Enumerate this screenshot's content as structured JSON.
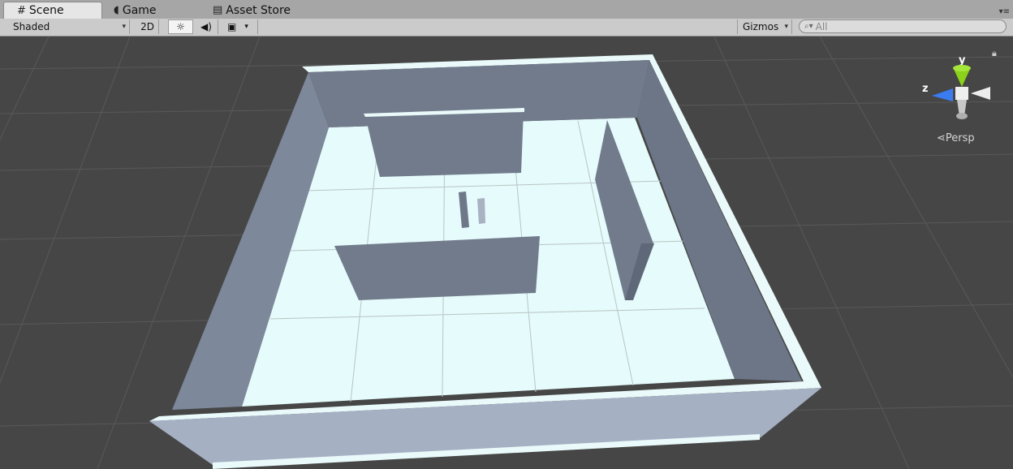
{
  "tabs": [
    {
      "label": "Scene",
      "icon": "grid-hash-icon",
      "active": true
    },
    {
      "label": "Game",
      "icon": "pacman-icon",
      "active": false
    },
    {
      "label": "Asset Store",
      "icon": "store-bag-icon",
      "active": false
    }
  ],
  "toolbar": {
    "draw_mode": "Shaded",
    "mode_2d": "2D",
    "lighting_icon": "sun-icon",
    "audio_icon": "speaker-icon",
    "effects_icon": "image-icon",
    "gizmos_label": "Gizmos",
    "search_placeholder": "All"
  },
  "viewport": {
    "background": "#464646",
    "projection_label": "Persp",
    "axis_labels": {
      "y": "y",
      "z": "z"
    },
    "axis_colors": {
      "y": "#8bd21a",
      "z": "#3b7bf0",
      "x": "#eeeeee"
    }
  },
  "scene_colors": {
    "floor": "#e6fbfb",
    "wall_face": "#717b8c",
    "wall_top": "#eafafa",
    "outer_front": "#a5b0c3"
  }
}
